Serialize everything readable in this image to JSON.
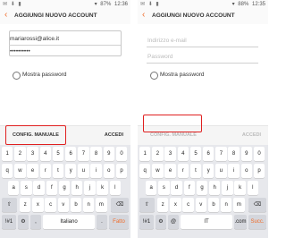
{
  "status_left": {
    "time": "12:36",
    "battery": "87%",
    "icons_left": "✉ ⬇ ▮"
  },
  "status_right": {
    "time": "12:35",
    "battery": "88%",
    "icons_left": "✉ ⬇ ▮"
  },
  "left": {
    "title": "AGGIUNGI NUOVO ACCOUNT",
    "email_value": "mariarossi@alice.it",
    "password_value": "••••••••••",
    "show_password": "Mostra password",
    "manual_config": "CONFIG. MANUALE",
    "login": "ACCEDI",
    "keyboard": {
      "numbers": [
        "1",
        "2",
        "3",
        "4",
        "5",
        "6",
        "7",
        "8",
        "9",
        "0"
      ],
      "row1": [
        "q",
        "w",
        "e",
        "r",
        "t",
        "y",
        "u",
        "i",
        "o",
        "p"
      ],
      "row2": [
        "a",
        "s",
        "d",
        "f",
        "g",
        "h",
        "j",
        "k",
        "l"
      ],
      "row3": [
        "z",
        "x",
        "c",
        "v",
        "b",
        "n",
        "m"
      ],
      "sym": "!#1",
      "comma": ",",
      "space": "Italiano",
      "dot": ".",
      "enter": "Fatto"
    }
  },
  "right": {
    "title": "AGGIUNGI NUOVO ACCOUNT",
    "email_placeholder": "Indirizzo e-mail",
    "password_placeholder": "Password",
    "show_password": "Mostra password",
    "manual_config": "CONFIG. MANUALE",
    "login": "ACCEDI",
    "keyboard": {
      "numbers": [
        "1",
        "2",
        "3",
        "4",
        "5",
        "6",
        "7",
        "8",
        "9",
        "0"
      ],
      "row1": [
        "q",
        "w",
        "e",
        "r",
        "t",
        "y",
        "u",
        "i",
        "o",
        "p"
      ],
      "row2": [
        "a",
        "s",
        "d",
        "f",
        "g",
        "h",
        "j",
        "k",
        "l"
      ],
      "row3": [
        "z",
        "x",
        "c",
        "v",
        "b",
        "n",
        "m"
      ],
      "sym": "!#1",
      "at": "@",
      "space": "IT",
      "dotcom": ".com",
      "enter": "Succ."
    }
  },
  "icons": {
    "back": "back-arrow-icon",
    "shift": "shift-icon",
    "backspace": "backspace-icon",
    "settings": "gear-icon"
  },
  "colors": {
    "accent": "#ef6c2a",
    "highlight": "#e02020"
  }
}
